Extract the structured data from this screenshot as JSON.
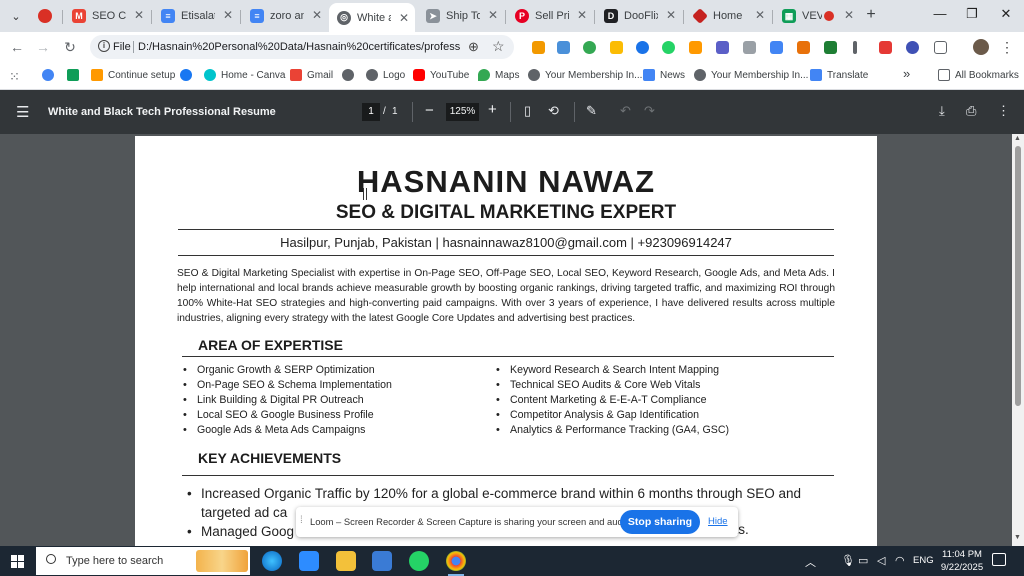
{
  "browser": {
    "tabs": [
      {
        "title": "",
        "color": "#d93025",
        "icon": "record-icon"
      },
      {
        "title": "SEO Cor",
        "color": "#ea4335",
        "icon": "gmail-icon"
      },
      {
        "title": "Etisalat",
        "color": "#4285f4",
        "icon": "docs-icon"
      },
      {
        "title": "zoro an",
        "color": "#4285f4",
        "icon": "docs-icon"
      },
      {
        "title": "White a",
        "color": "#5f6368",
        "icon": "globe-icon"
      },
      {
        "title": "Ship To",
        "color": "#5f6368",
        "icon": "ship-icon"
      },
      {
        "title": "Sell Prin",
        "color": "#e60023",
        "icon": "pinterest-icon"
      },
      {
        "title": "DooFlix",
        "color": "#202124",
        "icon": "dooflix-icon"
      },
      {
        "title": "Home",
        "color": "#c5221f",
        "icon": "home-icon"
      },
      {
        "title": "VEVC",
        "color": "#0f9d58",
        "icon": "sheets-icon"
      }
    ],
    "active_tab_index": 4,
    "window_controls": {
      "minimize": "—",
      "maximize": "❐",
      "close": "✕"
    },
    "new_tab_label": "+",
    "address": {
      "scheme": "File",
      "url": "D:/Hasnain%20Personal%20Data/Hasnain%20certificates/professio..."
    },
    "bookmarks": [
      {
        "label": "",
        "color": "#4285f4"
      },
      {
        "label": "",
        "color": "#0f9d58"
      },
      {
        "label": "Continue setup",
        "color": "#ff9900"
      },
      {
        "label": "",
        "color": "#1877f2"
      },
      {
        "label": "Home - Canva",
        "color": "#00c4cc"
      },
      {
        "label": "Gmail",
        "color": "#ea4335"
      },
      {
        "label": "",
        "color": "#5f6368"
      },
      {
        "label": "Logo",
        "color": "#5f6368"
      },
      {
        "label": "YouTube",
        "color": "#ff0000"
      },
      {
        "label": "Maps",
        "color": "#34a853"
      },
      {
        "label": "Your Membership In...",
        "color": "#5f6368"
      },
      {
        "label": "News",
        "color": "#4285f4"
      },
      {
        "label": "Your Membership In...",
        "color": "#5f6368"
      },
      {
        "label": "Translate",
        "color": "#4285f4"
      }
    ],
    "bookmarks_overflow": "»",
    "all_bookmarks_label": "All Bookmarks"
  },
  "pdf_viewer": {
    "title": "White and Black Tech Professional Resume",
    "current_page": "1",
    "page_separator": "/",
    "total_pages": "1",
    "zoom": "125%"
  },
  "resume": {
    "name": "HASNANIN NAWAZ",
    "role": "SEO & DIGITAL MARKETING EXPERT",
    "contact": "Hasilpur, Punjab, Pakistan | hasnainnawaz8100@gmail.com | +923096914247",
    "summary": "SEO & Digital Marketing Specialist with expertise in On-Page SEO, Off-Page SEO, Local SEO, Keyword Research, Google Ads, and Meta Ads. I help international and local brands achieve measurable growth by boosting organic rankings, driving targeted traffic, and maximizing ROI through 100% White-Hat SEO strategies and high-converting paid campaigns. With over 3 years of experience, I have delivered results across multiple industries, aligning every strategy with the latest Google Core Updates and advertising best practices.",
    "expertise_heading": "AREA OF EXPERTISE",
    "expertise_left": [
      "Organic Growth & SERP Optimization",
      "On-Page SEO & Schema Implementation",
      "Link Building & Digital PR Outreach",
      "Local SEO & Google Business Profile",
      "Google Ads & Meta Ads Campaigns"
    ],
    "expertise_right": [
      "Keyword Research & Search Intent Mapping",
      "Technical SEO Audits & Core Web Vitals",
      "Content Marketing & E-E-A-T Compliance",
      "Competitor Analysis & Gap Identification",
      "Analytics & Performance Tracking (GA4, GSC)"
    ],
    "achievements_heading": "KEY ACHIEVEMENTS",
    "achievements": [
      "Increased Organic Traffic by 120% for a global e-commerce brand within 6 months through SEO and targeted ad ca",
      "Managed Goog"
    ],
    "achievement_tail": "nts."
  },
  "loom_bar": {
    "message": "Loom – Screen Recorder & Screen Capture is sharing your screen and audio.",
    "stop_label": "Stop sharing",
    "hide_label": "Hide"
  },
  "taskbar": {
    "search_placeholder": "Type here to search",
    "language": "ENG",
    "time": "11:04 PM",
    "date": "9/22/2025"
  }
}
